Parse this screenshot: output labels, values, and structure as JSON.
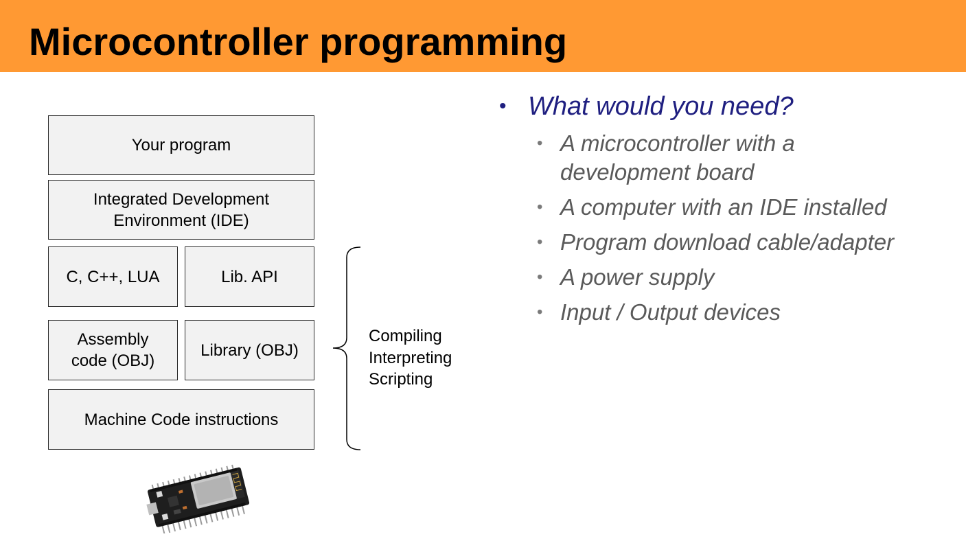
{
  "slide": {
    "title": "Microcontroller programming",
    "accent_color": "#ff9933"
  },
  "diagram": {
    "layers": {
      "your_program": "Your program",
      "ide": "Integrated Development\nEnvironment (IDE)",
      "languages": "C, C++, LUA",
      "lib_api": "Lib. API",
      "assembly": "Assembly\ncode (OBJ)",
      "library_obj": "Library (OBJ)",
      "machine_code": "Machine Code instructions"
    },
    "brace_label": [
      "Compiling",
      "Interpreting",
      "Scripting"
    ],
    "image": "esp32-development-board"
  },
  "bullets": {
    "heading": "What would you need?",
    "heading_color": "#1f1f80",
    "items": [
      "A microcontroller with a\ndevelopment board",
      "A computer with an IDE installed",
      "Program download cable/adapter",
      "A power supply",
      "Input / Output devices"
    ],
    "item_color": "#5a5a5a"
  }
}
